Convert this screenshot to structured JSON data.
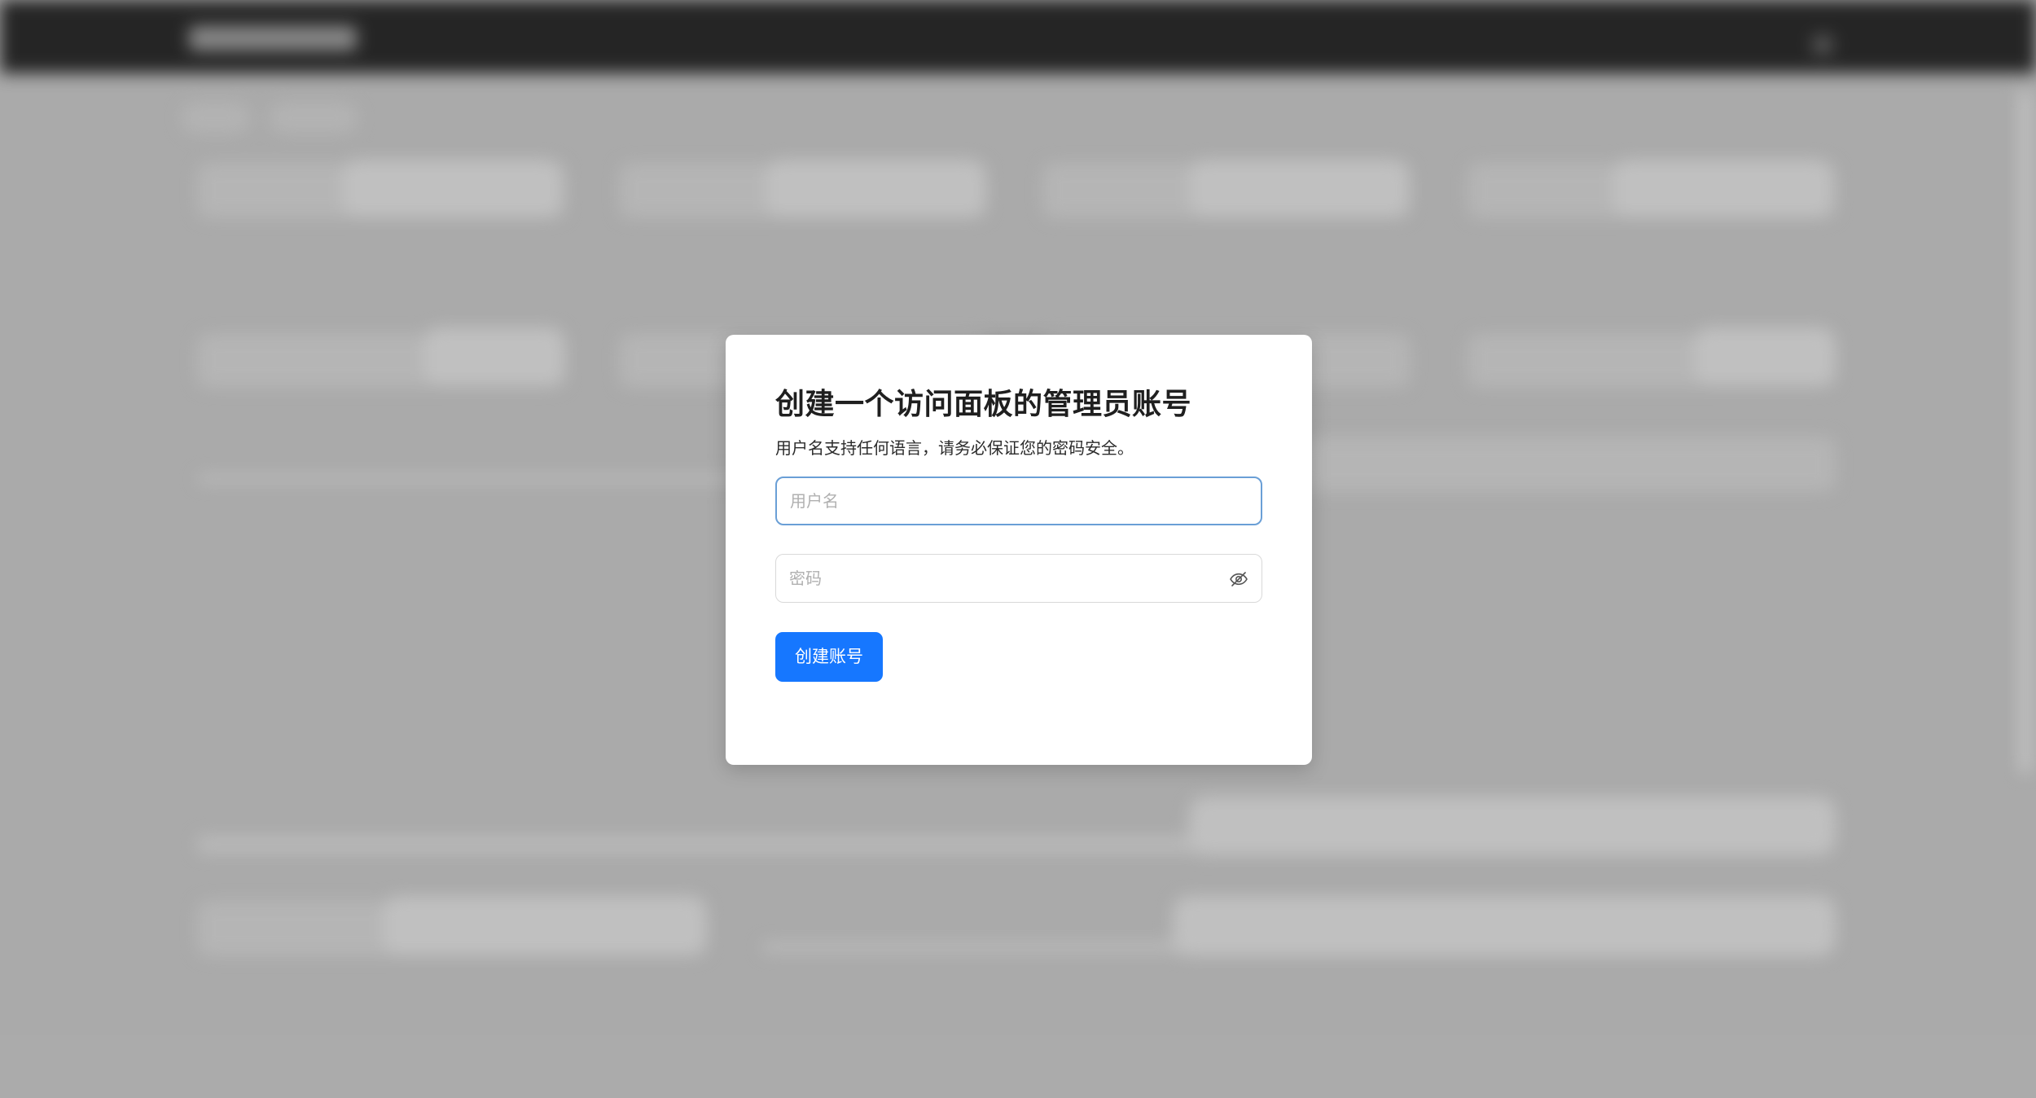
{
  "dialog": {
    "title": "创建一个访问面板的管理员账号",
    "subtitle": "用户名支持任何语言，请务必保证您的密码安全。",
    "username": {
      "value": "",
      "placeholder": "用户名"
    },
    "password": {
      "value": "",
      "placeholder": "密码",
      "toggle_icon": "eye-slash-icon"
    },
    "submit_label": "创建账号"
  },
  "colors": {
    "primary": "#1677ff",
    "backdrop": "#aeaeae",
    "topbar": "#262626",
    "focus_border": "#6a9fd6"
  }
}
